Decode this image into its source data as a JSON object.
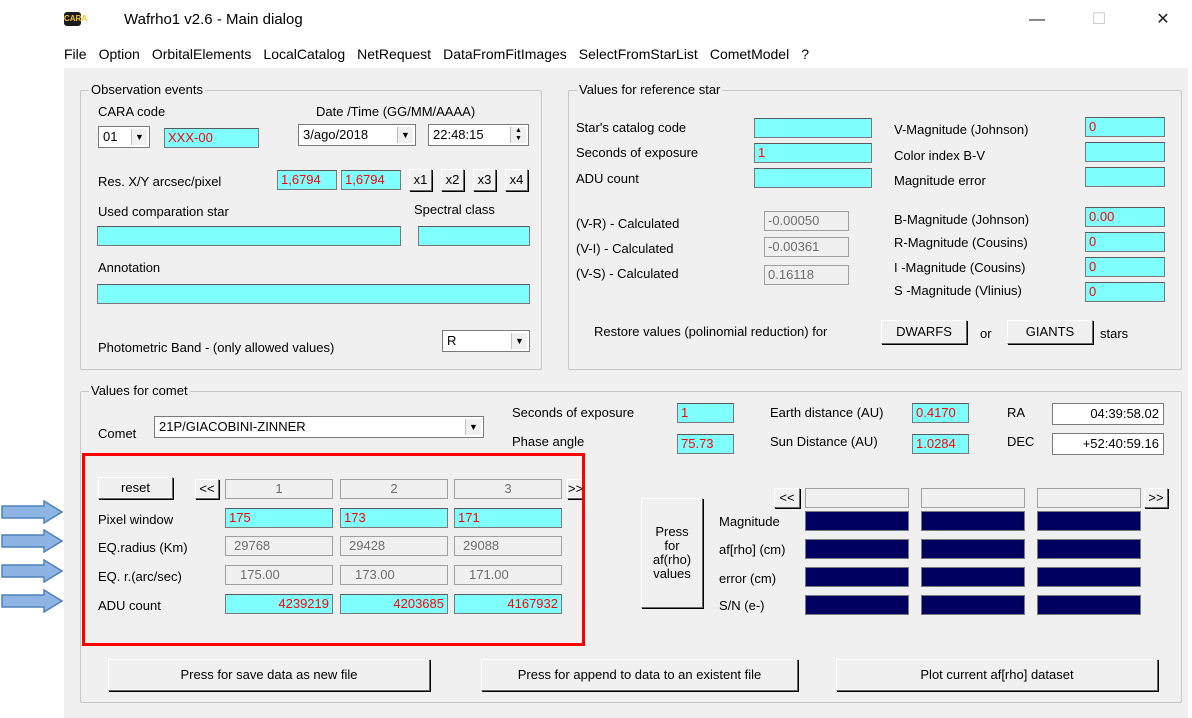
{
  "window": {
    "app_icon_text": "CARA",
    "title": "Wafrho1 v2.6 - Main dialog",
    "minimize": "—",
    "maximize": "☐",
    "close": "✕"
  },
  "menu": [
    "File",
    "Option",
    "OrbitalElements",
    "LocalCatalog",
    "NetRequest",
    "DataFromFitImages",
    "SelectFromStarList",
    "CometModel",
    "?"
  ],
  "observation": {
    "group_title": "Observation events",
    "cara_code_label": "CARA code",
    "date_time_label": "Date /Time  (GG/MM/AAAA)",
    "cara_code_value": "01",
    "cara_id": "XXX-00",
    "date_value": "3/ago/2018",
    "time_value": "22:48:15",
    "res_label": "Res. X/Y arcsec/pixel",
    "res_x": "1,6794",
    "res_y": "1,6794",
    "zoom_buttons": [
      "x1",
      "x2",
      "x3",
      "x4"
    ],
    "comp_star_label": "Used comparation star",
    "spectral_label": "Spectral class",
    "comp_star_value": "",
    "spectral_value": "",
    "annotation_label": "Annotation",
    "annotation_value": "",
    "band_label": "Photometric Band  - (only allowed values)",
    "band_value": "R"
  },
  "reference": {
    "group_title": "Values for reference star",
    "catalog_label": "Star's catalog code",
    "exposure_label": "Seconds of exposure",
    "adu_label": "ADU count",
    "catalog_value": "",
    "exposure_value": "1",
    "adu_value": "",
    "vmag_label": "V-Magnitude (Johnson)",
    "bv_label": "Color index B-V",
    "magerr_label": "Magnitude error",
    "vmag_value": "0",
    "bv_value": "",
    "magerr_value": "",
    "vr_label": "(V-R) - Calculated",
    "vi_label": "(V-I)  - Calculated",
    "vs_label": "(V-S) - Calculated",
    "vr_value": "-0.00050",
    "vi_value": "-0.00361",
    "vs_value": "0.16118",
    "bmag_label": "B-Magnitude (Johnson)",
    "rmag_label": "R-Magnitude (Cousins)",
    "imag_label": "I -Magnitude (Cousins)",
    "smag_label": "S -Magnitude (Vlinius)",
    "bmag_value": "0.00",
    "rmag_value": "0",
    "imag_value": "0",
    "smag_value": "0",
    "restore_label": "Restore values (polinomial reduction) for",
    "dwarfs": "DWARFS",
    "or": "or",
    "giants": "GIANTS",
    "stars": "stars"
  },
  "comet": {
    "group_title": "Values for comet",
    "comet_label": "Comet",
    "comet_value": "21P/GIACOBINI-ZINNER",
    "exposure_label": "Seconds of exposure",
    "exposure_value": "1",
    "phase_label": "Phase angle",
    "phase_value": "75.73",
    "earth_label": "Earth distance (AU)",
    "earth_value": "0.4170",
    "sun_label": "Sun Distance (AU)",
    "sun_value": "1.0284",
    "ra_label": "RA",
    "ra_value": "04:39:58.02",
    "dec_label": "DEC",
    "dec_value": "+52:40:59.16",
    "reset": "reset",
    "nav_prev": "<<",
    "nav_next": ">>",
    "columns": [
      "1",
      "2",
      "3"
    ],
    "pixel_window_label": "Pixel window",
    "pixel_window": [
      "175",
      "173",
      "171"
    ],
    "eq_radius_label": "EQ.radius (Km)",
    "eq_radius": [
      "29768",
      "29428",
      "29088"
    ],
    "eq_r_label": "EQ. r.(arc/sec)",
    "eq_r": [
      "175.00",
      "173.00",
      "171.00"
    ],
    "adu_label": "ADU count",
    "adu": [
      "4239219",
      "4203685",
      "4167932"
    ],
    "press_button": [
      "Press",
      "for",
      "af(rho)",
      "values"
    ],
    "right_nav_prev": "<<",
    "right_nav_next": ">>",
    "right_columns": [
      "",
      "",
      ""
    ],
    "magnitude_label": "Magnitude",
    "afrho_label": "af[rho] (cm)",
    "error_label": "error (cm)",
    "sn_label": "S/N (e-)"
  },
  "bottom": {
    "save_new": "Press for save data as new file",
    "append": "Press for append to  data to an existent file",
    "plot": "Plot current af[rho] dataset"
  },
  "colors": {
    "field_cyan": "#80ffff",
    "value_red": "#ff0000",
    "annotation_red": "#ff0000",
    "arrow_blue": "#8eb4e3",
    "navy": "#000060"
  }
}
